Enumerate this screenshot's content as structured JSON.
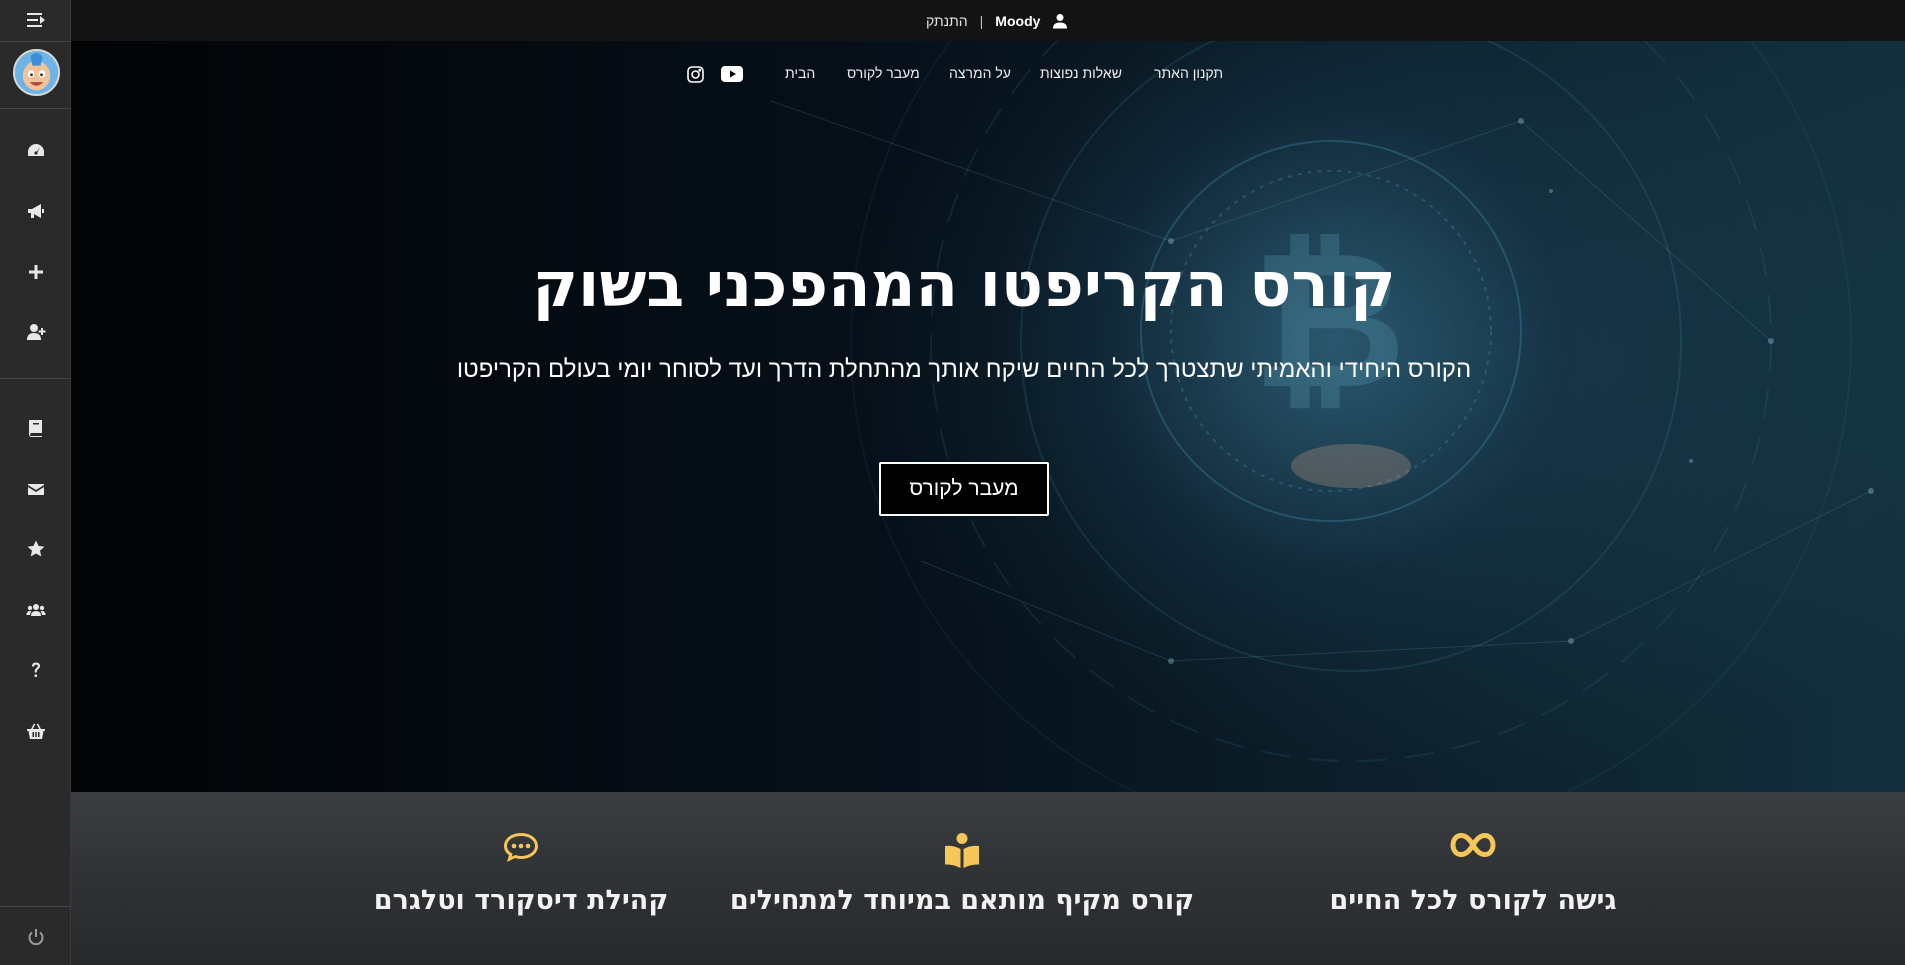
{
  "topbar": {
    "username": "Moody",
    "separator": "|",
    "logout_label": "התנתק"
  },
  "nav": {
    "items": [
      {
        "label": "תקנון האתר"
      },
      {
        "label": "שאלות נפוצות"
      },
      {
        "label": "על המרצה"
      },
      {
        "label": "מעבר לקורס"
      },
      {
        "label": "הבית"
      }
    ]
  },
  "hero": {
    "title": "קורס הקריפטו המהפכני בשוק",
    "subtitle": "הקורס היחידי והאמיתי שתצטרך לכל החיים שיקח אותך מהתחלת הדרך ועד לסוחר יומי בעולם הקריפטו",
    "button_label": "מעבר לקורס"
  },
  "features": [
    {
      "title": "קהילת דיסקורד וטלגרם",
      "icon": "chat-icon"
    },
    {
      "title": "קורס מקיף מותאם במיוחד למתחילים",
      "icon": "book-reader-icon"
    },
    {
      "title": "גישה לקורס לכל החיים",
      "icon": "infinity-icon"
    }
  ],
  "sidebar": {
    "icons": [
      "menu-toggle-icon",
      "dashboard-icon",
      "megaphone-icon",
      "plus-icon",
      "user-plus-icon",
      "book-icon",
      "envelope-icon",
      "star-icon",
      "users-icon",
      "question-icon",
      "basket-icon",
      "power-icon"
    ]
  },
  "colors": {
    "accent": "#f5c65a",
    "sidebar_bg": "#2a2a2a",
    "topbar_bg": "#131313",
    "features_bg": "#303335"
  }
}
